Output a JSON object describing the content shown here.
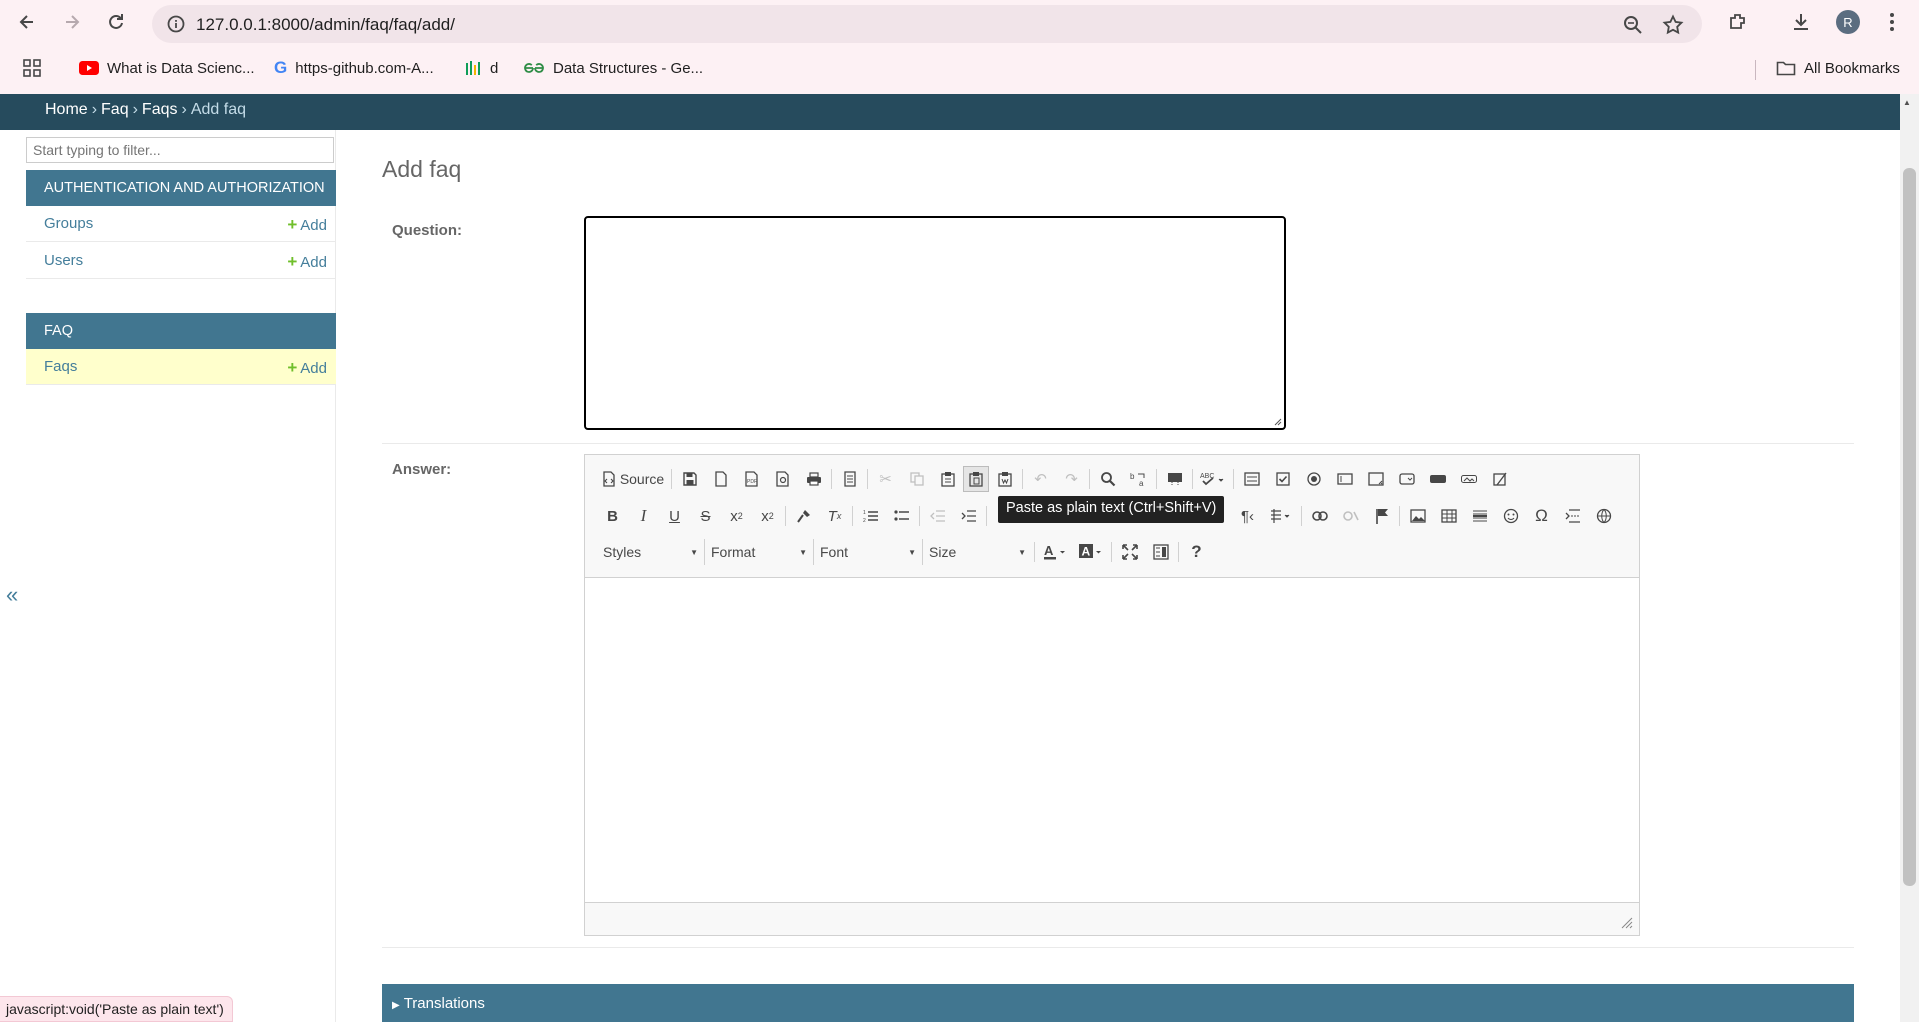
{
  "browser": {
    "url": "127.0.0.1:8000/admin/faq/faq/add/",
    "profile_initial": "R",
    "bookmarks": [
      {
        "label": "What is Data Scienc...",
        "icon": "youtube-icon"
      },
      {
        "label": "https-github.com-A...",
        "icon": "google-icon"
      },
      {
        "label": "d",
        "icon": "chart-icon"
      },
      {
        "label": "Data Structures - Ge...",
        "icon": "geeksforgeeks-icon"
      }
    ],
    "all_bookmarks_label": "All Bookmarks"
  },
  "breadcrumbs": {
    "home": "Home",
    "app": "Faq",
    "model": "Faqs",
    "current": "Add faq",
    "separator": "›"
  },
  "sidebar": {
    "filter_placeholder": "Start typing to filter...",
    "modules": [
      {
        "title": "AUTHENTICATION AND AUTHORIZATION",
        "rows": [
          {
            "label": "Groups",
            "add": "Add"
          },
          {
            "label": "Users",
            "add": "Add"
          }
        ]
      },
      {
        "title": "FAQ",
        "rows": [
          {
            "label": "Faqs",
            "add": "Add"
          }
        ]
      }
    ],
    "collapse_glyph": "«"
  },
  "content": {
    "title": "Add faq",
    "question_label": "Question:",
    "answer_label": "Answer:",
    "translations_label": "Translations"
  },
  "editor": {
    "source_label": "Source",
    "combos": {
      "styles": "Styles",
      "format": "Format",
      "font": "Font",
      "size": "Size"
    },
    "tooltip": "Paste as plain text (Ctrl+Shift+V)"
  },
  "status_bar": "javascript:void('Paste as plain text')",
  "colors": {
    "header": "#264b5d",
    "module": "#417690",
    "link": "#447e9b",
    "add_plus": "#70bf2b",
    "selected_row": "#ffffcc"
  }
}
